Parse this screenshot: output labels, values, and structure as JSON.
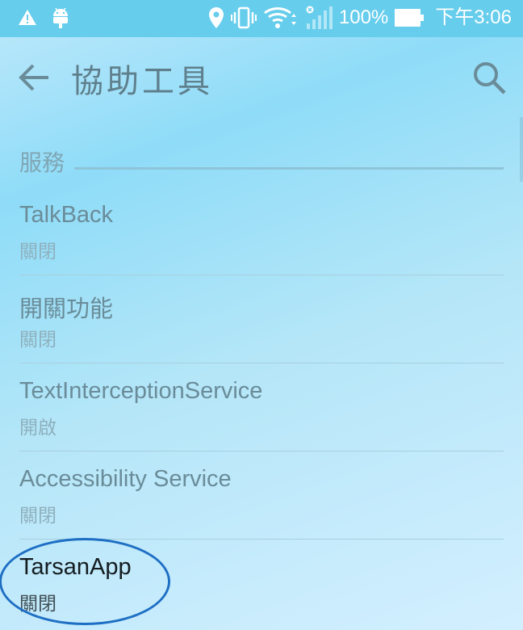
{
  "status_bar": {
    "battery_percent": "100%",
    "time": "下午3:06",
    "icons": [
      "warning-icon",
      "android-icon",
      "location-icon",
      "vibrate-icon",
      "wifi-icon",
      "cellular-signal-icon",
      "battery-icon"
    ]
  },
  "app_bar": {
    "title": "協助工具",
    "back_icon": "arrow-back-icon",
    "search_icon": "search-icon"
  },
  "section": {
    "title": "服務"
  },
  "services": [
    {
      "name": "TalkBack",
      "status": "關閉"
    },
    {
      "name": "開關功能",
      "status": "關閉"
    },
    {
      "name": "TextInterceptionService",
      "status": "開啟"
    },
    {
      "name": "Accessibility Service",
      "status": "關閉"
    },
    {
      "name": "TarsanApp",
      "status": "關閉"
    }
  ],
  "colors": {
    "status_bar": "#66cdec",
    "title_text": "#5f7f8c",
    "highlight_ring": "#1e6fc4"
  }
}
